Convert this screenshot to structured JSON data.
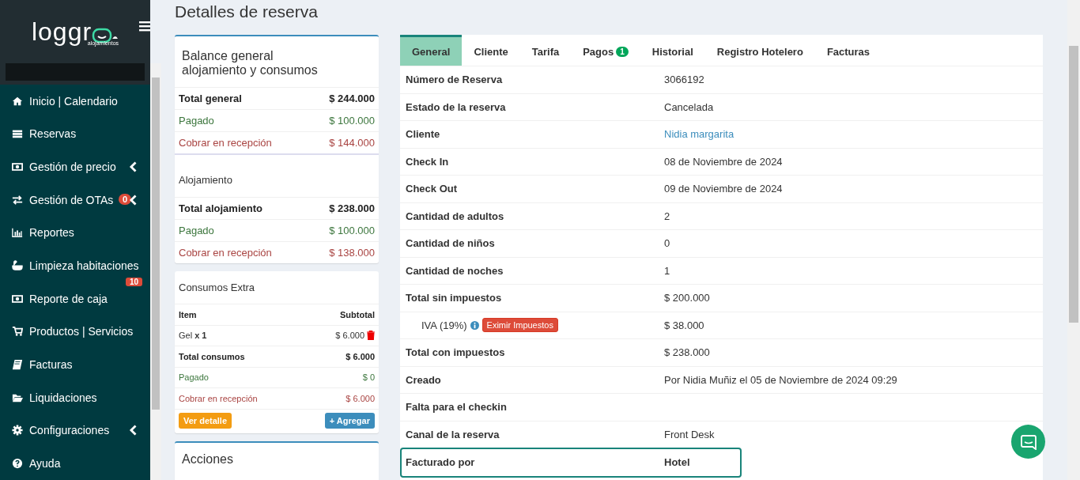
{
  "sidebar": {
    "logo": "loggr",
    "logo_sub": "alojamientos",
    "items": [
      {
        "label": "Inicio | Calendario",
        "caret": false
      },
      {
        "label": "Reservas",
        "caret": false
      },
      {
        "label": "Gestión de precio",
        "caret": true
      },
      {
        "label": "Gestión de OTAs",
        "caret": true,
        "badge": "0"
      },
      {
        "label": "Reportes",
        "caret": false
      },
      {
        "label": "Limpieza habitaciones",
        "caret": false,
        "badge": "10"
      },
      {
        "label": "Reporte de caja",
        "caret": false
      },
      {
        "label": "Productos | Servicios",
        "caret": false
      },
      {
        "label": "Facturas",
        "caret": false
      },
      {
        "label": "Liquidaciones",
        "caret": false
      },
      {
        "label": "Configuraciones",
        "caret": true
      },
      {
        "label": "Ayuda",
        "caret": false
      }
    ]
  },
  "page_title": "Detalles de reserva",
  "balance": {
    "title": "Balance general alojamiento y consumos",
    "rows": [
      {
        "kind": "total",
        "label": "Total general",
        "value": "$ 244.000"
      },
      {
        "kind": "paid",
        "label": "Pagado",
        "value": "$ 100.000"
      },
      {
        "kind": "due",
        "label": "Cobrar en recepción",
        "value": "$ 144.000"
      }
    ],
    "section": "Alojamiento",
    "section_rows": [
      {
        "kind": "total",
        "label": "Total alojamiento",
        "value": "$ 238.000"
      },
      {
        "kind": "paid",
        "label": "Pagado",
        "value": "$ 100.000"
      },
      {
        "kind": "due",
        "label": "Cobrar en recepción",
        "value": "$ 138.000"
      }
    ]
  },
  "extras": {
    "title": "Consumos Extra",
    "columns": [
      "Item",
      "Subtotal"
    ],
    "rows": [
      {
        "kind": "item",
        "label": "Gel **x 1**",
        "value": "$ 6.000"
      },
      {
        "kind": "total",
        "label": "Total consumos",
        "value": "$ 6.000"
      },
      {
        "kind": "paid",
        "label": "Pagado",
        "value": "$ 0"
      },
      {
        "kind": "due",
        "label": "Cobrar en recepción",
        "value": "$ 6.000"
      }
    ],
    "detail_button": "Ver detalle",
    "add_button": "+ Agregar"
  },
  "actions": {
    "title": "Acciones"
  },
  "tabs": [
    {
      "label": "General",
      "selected": true
    },
    {
      "label": "Cliente",
      "selected": false
    },
    {
      "label": "Tarifa",
      "selected": false
    },
    {
      "label": "Pagos",
      "selected": false,
      "badge": "1"
    },
    {
      "label": "Historial",
      "selected": false
    },
    {
      "label": "Registro Hotelero",
      "selected": false
    },
    {
      "label": "Facturas",
      "selected": false
    }
  ],
  "details": [
    {
      "kind": "text",
      "label": "Número de Reserva",
      "value": "3066192"
    },
    {
      "kind": "text",
      "label": "Estado de la reserva",
      "value": "Cancelada"
    },
    {
      "kind": "link",
      "label": "Cliente",
      "value": "Nidia margarita"
    },
    {
      "kind": "text",
      "label": "Check In",
      "value": "08 de Noviembre de 2024"
    },
    {
      "kind": "text",
      "label": "Check Out",
      "value": "09 de Noviembre de 2024"
    },
    {
      "kind": "text",
      "label": "Cantidad de adultos",
      "value": "2"
    },
    {
      "kind": "text",
      "label": "Cantidad de niños",
      "value": "0"
    },
    {
      "kind": "text",
      "label": "Cantidad de noches",
      "value": "1"
    },
    {
      "kind": "text",
      "label": "Total sin impuestos",
      "value": "$ 200.000"
    },
    {
      "kind": "tax",
      "label": "IVA (19%)",
      "value": "$ 38.000",
      "button": "Eximir Impuestos"
    },
    {
      "kind": "text",
      "label": "Total con impuestos",
      "value": "$ 238.000"
    },
    {
      "kind": "text",
      "label": "Creado",
      "value": "Por Nidia Muñiz el 05 de Noviembre de 2024 09:29"
    },
    {
      "kind": "text",
      "label": "Falta para el checkin"
    },
    {
      "kind": "text",
      "label": "Canal de la reserva",
      "value": "Front Desk"
    },
    {
      "kind": "highlight",
      "label": "Facturado por",
      "value": "Hotel"
    }
  ]
}
